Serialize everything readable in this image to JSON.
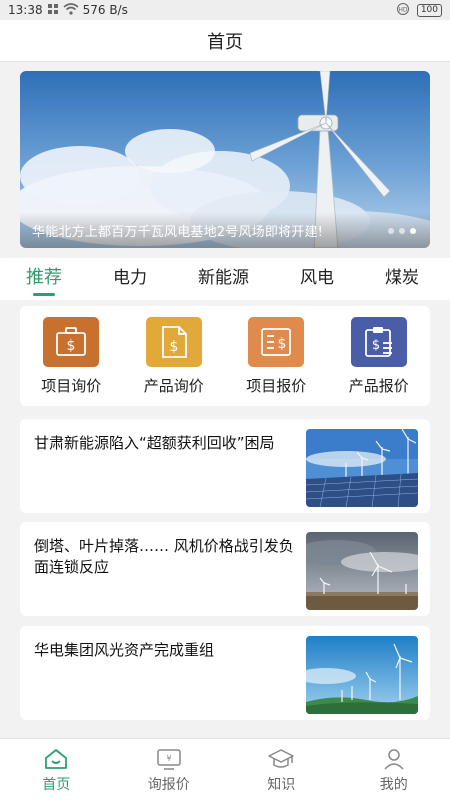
{
  "status_bar": {
    "time": "13:38",
    "network_speed": "576 B/s",
    "battery": "100",
    "icons": [
      "grid-icon",
      "wifi-icon",
      "hd-icon",
      "battery-icon"
    ]
  },
  "header": {
    "title": "首页"
  },
  "banner": {
    "caption": "华能北方上都百万千瓦风电基地2号风场即将开建!",
    "dots": [
      false,
      false,
      true
    ]
  },
  "tabs": [
    {
      "label": "推荐",
      "active": true
    },
    {
      "label": "电力",
      "active": false
    },
    {
      "label": "新能源",
      "active": false
    },
    {
      "label": "风电",
      "active": false
    },
    {
      "label": "煤炭",
      "active": false
    }
  ],
  "quick_actions": [
    {
      "label": "项目询价",
      "icon": "briefcase-dollar-icon",
      "color": "#c8702e"
    },
    {
      "label": "产品询价",
      "icon": "document-dollar-icon",
      "color": "#e0a93a"
    },
    {
      "label": "项目报价",
      "icon": "list-dollar-icon",
      "color": "#e08a4e"
    },
    {
      "label": "产品报价",
      "icon": "clipboard-dollar-icon",
      "color": "#4a5ea8"
    }
  ],
  "news": [
    {
      "title": "甘肃新能源陷入“超额获利回收”困局",
      "thumb": "solar-wind-icon"
    },
    {
      "title": "倒塔、叶片掉落…… 风机价格战引发负面连锁反应",
      "thumb": "wind-field-icon"
    },
    {
      "title": "华电集团风光资产完成重组",
      "thumb": "wind-coast-icon"
    }
  ],
  "bottom_nav": [
    {
      "label": "首页",
      "icon": "home-icon",
      "active": true
    },
    {
      "label": "询报价",
      "icon": "quote-icon",
      "active": false
    },
    {
      "label": "知识",
      "icon": "graduation-cap-icon",
      "active": false
    },
    {
      "label": "我的",
      "icon": "user-icon",
      "active": false
    }
  ],
  "colors": {
    "accent": "#2e9e6f"
  }
}
